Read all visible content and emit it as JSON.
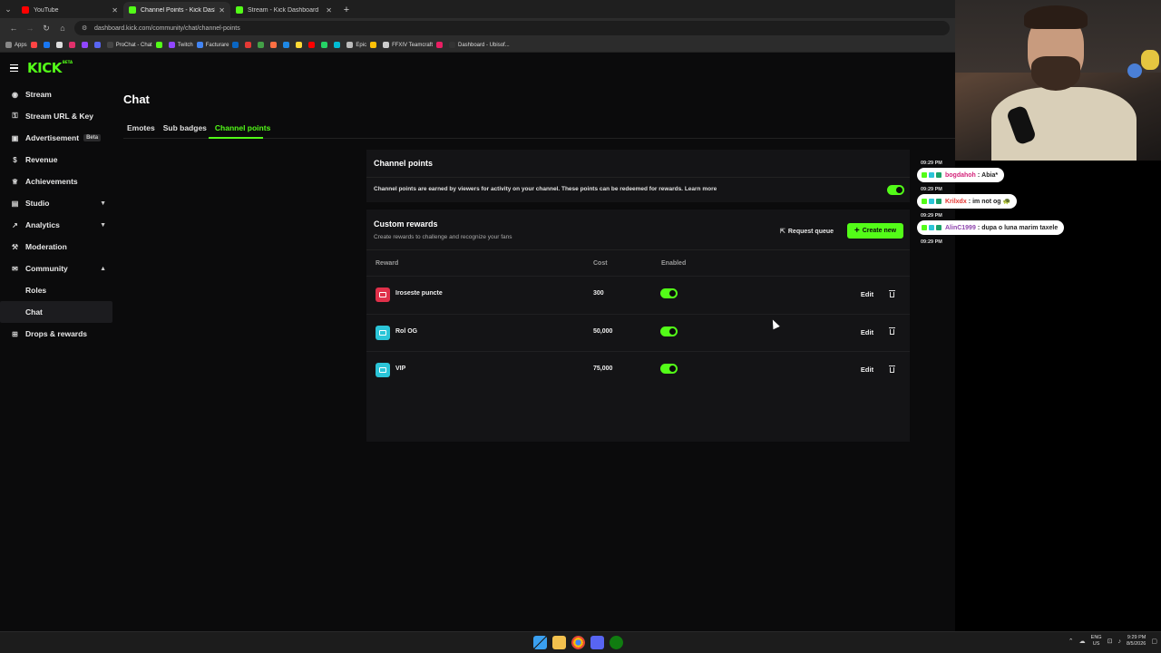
{
  "browser": {
    "tabs": [
      {
        "title": "YouTube",
        "color": "#ff0000"
      },
      {
        "title": "Channel Points - Kick Dashboard",
        "color": "#53fc18"
      },
      {
        "title": "Stream - Kick Dashboard",
        "color": "#53fc18"
      }
    ],
    "new_tab_label": "+",
    "url": "dashboard.kick.com/community/chat/channel-points",
    "bookmarks": [
      {
        "label": "Apps",
        "color": "#888888"
      },
      {
        "label": "",
        "color": "#ff4444"
      },
      {
        "label": "",
        "color": "#1877f2"
      },
      {
        "label": "",
        "color": "#dddddd"
      },
      {
        "label": "",
        "color": "#e1306c"
      },
      {
        "label": "",
        "color": "#9146ff"
      },
      {
        "label": "",
        "color": "#5865f2"
      },
      {
        "label": "ProChat - Chat",
        "color": "#444444"
      },
      {
        "label": "",
        "color": "#53fc18"
      },
      {
        "label": "Twitch",
        "color": "#9146ff"
      },
      {
        "label": "Facturare",
        "color": "#4285f4"
      },
      {
        "label": "",
        "color": "#0a66c2"
      },
      {
        "label": "",
        "color": "#e53935"
      },
      {
        "label": "",
        "color": "#43a047"
      },
      {
        "label": "",
        "color": "#ff7043"
      },
      {
        "label": "",
        "color": "#1e88e5"
      },
      {
        "label": "",
        "color": "#fdd835"
      },
      {
        "label": "",
        "color": "#ff0000"
      },
      {
        "label": "",
        "color": "#25d366"
      },
      {
        "label": "",
        "color": "#00bcd4"
      },
      {
        "label": "Epic",
        "color": "#bbbbbb"
      },
      {
        "label": "",
        "color": "#ffc107"
      },
      {
        "label": "FFXIV Teamcraft",
        "color": "#cccccc"
      },
      {
        "label": "",
        "color": "#e91e63"
      },
      {
        "label": "Dashboard - Ubisof...",
        "color": "#333333"
      }
    ]
  },
  "app": {
    "logo": "KICK",
    "logo_sup": "BETA",
    "sidebar": [
      {
        "label": "Stream",
        "icon": "broadcast-icon",
        "glyph": "◉"
      },
      {
        "label": "Stream URL & Key",
        "icon": "key-icon",
        "glyph": "⚿"
      },
      {
        "label": "Advertisement",
        "icon": "ad-icon",
        "glyph": "▣",
        "badge": "Beta"
      },
      {
        "label": "Revenue",
        "icon": "revenue-icon",
        "glyph": "$"
      },
      {
        "label": "Achievements",
        "icon": "trophy-icon",
        "glyph": "♕"
      },
      {
        "label": "Studio",
        "icon": "studio-icon",
        "glyph": "▤",
        "chevron": "▼"
      },
      {
        "label": "Analytics",
        "icon": "chart-icon",
        "glyph": "↗",
        "chevron": "▼"
      },
      {
        "label": "Moderation",
        "icon": "wrench-icon",
        "glyph": "⚒"
      },
      {
        "label": "Community",
        "icon": "community-icon",
        "glyph": "✉",
        "chevron": "▲"
      }
    ],
    "sidebar_sub": [
      "Roles",
      "Chat"
    ],
    "sidebar_last": {
      "label": "Drops & rewards",
      "icon": "gift-icon",
      "glyph": "⊞"
    },
    "page_title": "Chat",
    "subtabs": [
      "Emotes",
      "Sub badges",
      "Channel points"
    ],
    "channel_points": {
      "heading": "Channel points",
      "description": "Channel points are earned by viewers for activity on your channel. These points can be redeemed for rewards.",
      "learn_more": "Learn more",
      "enabled": true
    },
    "custom_rewards": {
      "heading": "Custom rewards",
      "subheading": "Create rewards to challenge and recognize your fans",
      "request_queue": "Request queue",
      "create_new": "Create new",
      "columns": {
        "reward": "Reward",
        "cost": "Cost",
        "enabled": "Enabled"
      },
      "rows": [
        {
          "name": "Iroseste puncte",
          "cost": "300",
          "color": "#e0304a",
          "enabled": true,
          "edit": "Edit"
        },
        {
          "name": "Rol OG",
          "cost": "50,000",
          "color": "#2bc5d8",
          "enabled": true,
          "edit": "Edit"
        },
        {
          "name": "VIP",
          "cost": "75,000",
          "color": "#2bc5d8",
          "enabled": true,
          "edit": "Edit"
        }
      ]
    }
  },
  "chat_overlay": [
    {
      "time": "09:29 PM",
      "user": "bogdahoh",
      "user_color": "#d4237a",
      "text": "Abia*"
    },
    {
      "time": "09:29 PM",
      "user": "Krilxdx",
      "user_color": "#e3342f",
      "text": "im not og 🐢"
    },
    {
      "time": "09:29 PM",
      "user": "AlinC1999",
      "user_color": "#8e44ad",
      "text": "dupa o luna marim taxele"
    },
    {
      "time": "09:29 PM"
    }
  ],
  "taskbar": {
    "lang_top": "ENG",
    "lang_bottom": "US",
    "time": "9:29 PM",
    "date": "8/5/2026"
  },
  "colors": {
    "accent": "#53fc18",
    "background": "#0b0b0c",
    "panel": "#141416"
  }
}
